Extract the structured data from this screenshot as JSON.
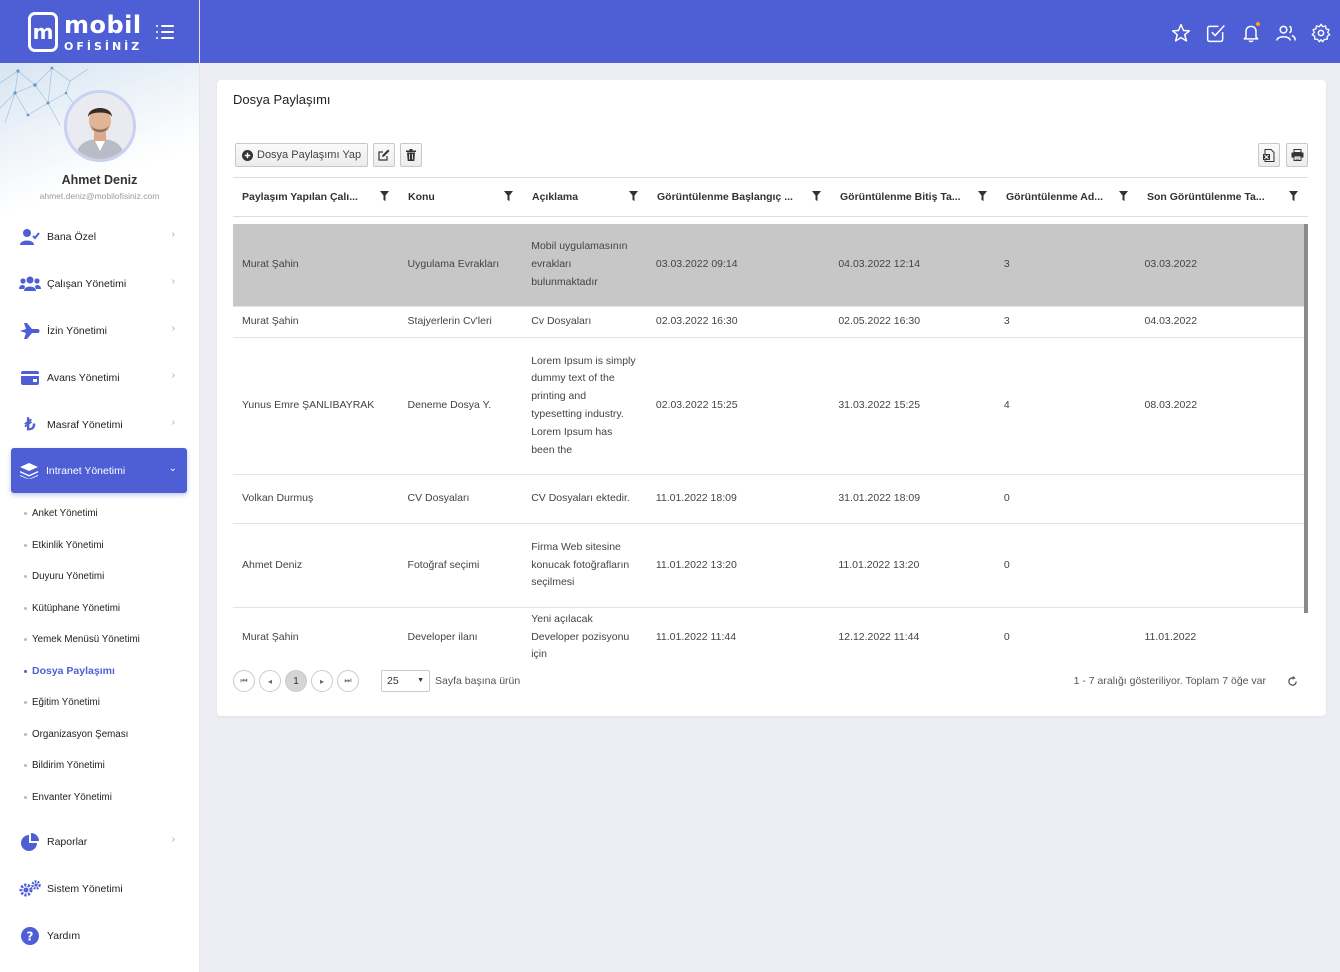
{
  "brand": {
    "line1": "mobil",
    "line2": "OFİSİNİZ",
    "mark": "m"
  },
  "user": {
    "name": "Ahmet Deniz",
    "email": "ahmet.deniz@mobilofisiniz.com"
  },
  "menu": [
    {
      "label": "Bana Özel",
      "icon": "user-check-icon"
    },
    {
      "label": "Çalışan Yönetimi",
      "icon": "users-icon"
    },
    {
      "label": "İzin Yönetimi",
      "icon": "plane-icon"
    },
    {
      "label": "Avans Yönetimi",
      "icon": "wallet-icon"
    },
    {
      "label": "Masraf Yönetimi",
      "icon": "lira-icon"
    },
    {
      "label": "Intranet Yönetimi",
      "icon": "layers-icon"
    }
  ],
  "submenu": [
    "Anket Yönetimi",
    "Etkinlik Yönetimi",
    "Duyuru Yönetimi",
    "Kütüphane Yönetimi",
    "Yemek Menüsü Yönetimi",
    "Dosya Paylaşımı",
    "Eğitim Yönetimi",
    "Organizasyon Şeması",
    "Bildirim Yönetimi",
    "Envanter Yönetimi"
  ],
  "menu_bottom": [
    {
      "label": "Raporlar",
      "icon": "pie-chart-icon"
    },
    {
      "label": "Sistem Yönetimi",
      "icon": "gears-icon"
    },
    {
      "label": "Yardım",
      "icon": "help-icon"
    }
  ],
  "header_icons": [
    "star-icon",
    "task-check-icon",
    "bell-icon",
    "people-icon",
    "settings-gear-icon"
  ],
  "page": {
    "title": "Dosya Paylaşımı"
  },
  "toolbar": {
    "add_label": "Dosya Paylaşımı Yap"
  },
  "grid": {
    "columns": [
      "Paylaşım Yapılan Çalı...",
      "Konu",
      "Açıklama",
      "Görüntülenme Başlangıç ...",
      "Görüntülenme Bitiş Ta...",
      "Görüntülenme Ad...",
      "Son Görüntülenme Ta..."
    ],
    "rows": [
      [
        "Murat Şahin",
        "Uygulama Evrakları",
        "Mobil uygulamasının evrakları bulunmaktadır",
        "03.03.2022 09:14",
        "04.03.2022 12:14",
        "3",
        "03.03.2022"
      ],
      [
        "Murat Şahin",
        "Stajyerlerin Cv'leri",
        "Cv Dosyaları",
        "02.03.2022 16:30",
        "02.05.2022 16:30",
        "3",
        "04.03.2022"
      ],
      [
        "Yunus Emre ŞANLIBAYRAK",
        "Deneme Dosya Y.",
        "Lorem Ipsum is simply dummy text of the printing and typesetting industry. Lorem Ipsum has been the",
        "02.03.2022 15:25",
        "31.03.2022 15:25",
        "4",
        "08.03.2022"
      ],
      [
        "Volkan Durmuş",
        "CV Dosyaları",
        "CV Dosyaları ektedir.",
        "11.01.2022 18:09",
        "31.01.2022 18:09",
        "0",
        ""
      ],
      [
        "Ahmet Deniz",
        "Fotoğraf seçimi",
        "Firma Web sitesine konucak fotoğrafların seçilmesi",
        "11.01.2022 13:20",
        "11.01.2022 13:20",
        "0",
        ""
      ],
      [
        "Murat Şahin",
        "Developer ilanı",
        "Yeni açılacak Developer pozisyonu için",
        "11.01.2022 11:44",
        "12.12.2022 11:44",
        "0",
        "11.01.2022"
      ]
    ]
  },
  "pager": {
    "current_page": "1",
    "page_size": "25",
    "per_page_label": "Sayfa başına ürün",
    "info": "1 - 7 aralığı gösteriliyor. Toplam 7 öğe var"
  },
  "colors": {
    "primary": "#4e5fd6",
    "selected_row": "#c7c7c7"
  }
}
